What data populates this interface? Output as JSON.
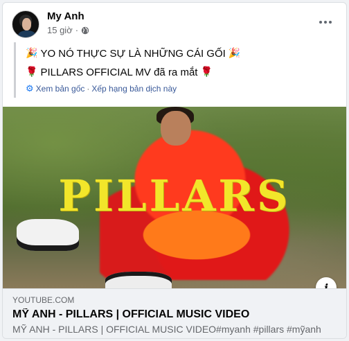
{
  "post": {
    "author": "My Anh",
    "time": "15 giờ",
    "separator": "·",
    "privacy_icon": "globe-icon",
    "more_icon": "more-horizontal-icon"
  },
  "translation": {
    "line1": "YO NÓ THỰC SỰ LÀ NHỮNG CÁI GỐI",
    "line1_emoji": "🎉",
    "line2": "PILLARS OFFICIAL MV đã ra mắt",
    "line2_emoji": "🌹",
    "see_original": "Xem bản gốc",
    "dot": "·",
    "rate_translation": "Xếp hạng bản dịch này",
    "settings_icon": "gear-icon"
  },
  "thumbnail": {
    "overlay_text": "PILLARS",
    "info_icon": "info-icon",
    "info_label": "i"
  },
  "link_preview": {
    "source": "YOUTUBE.COM",
    "title": "MỸ ANH - PILLARS | OFFICIAL MUSIC VIDEO",
    "description": "MỸ ANH - PILLARS | OFFICIAL MUSIC VIDEO#myanh #pillars #mỹanh"
  },
  "colors": {
    "link": "#385898",
    "overlay_text": "#f2e62a",
    "accent": "#1877f2"
  }
}
